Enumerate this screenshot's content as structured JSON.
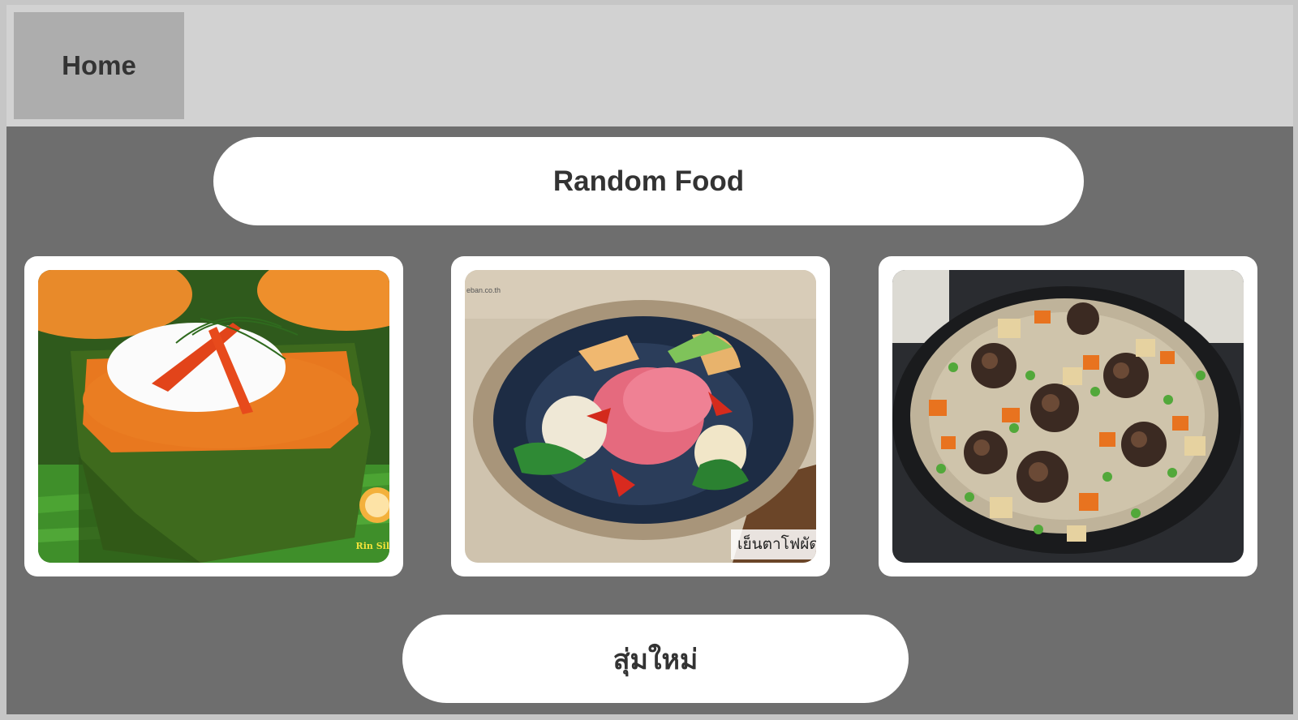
{
  "nav": {
    "home_label": "Home"
  },
  "header": {
    "title": "Random Food"
  },
  "foods": [
    {
      "name": "hor-mok-curry-custard",
      "watermark": "Rin Sil"
    },
    {
      "name": "yen-ta-fo-stir-fry",
      "caption": "เย็นตาโฟผัด",
      "watermark": "eban.co.th"
    },
    {
      "name": "mushroom-fried-rice",
      "caption": ""
    }
  ],
  "actions": {
    "reshuffle_label": "สุ่มใหม่"
  }
}
